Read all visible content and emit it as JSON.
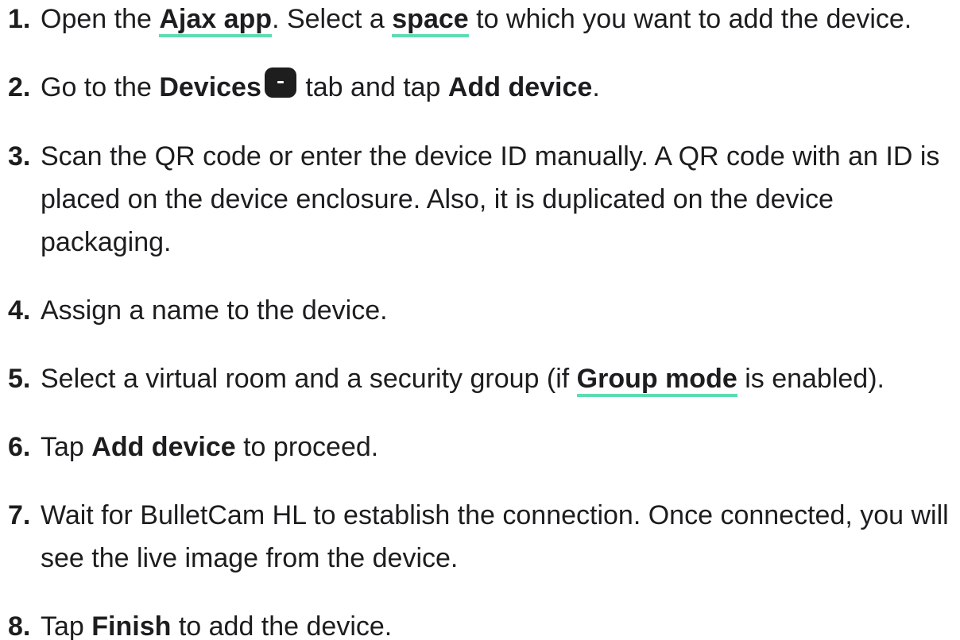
{
  "steps": [
    {
      "number": "1.",
      "t1": "Open the ",
      "link1": "Ajax app",
      "t2": ". Select a ",
      "link2": "space",
      "t3": " to which you want to add the device."
    },
    {
      "number": "2.",
      "t1": "Go to the ",
      "bold1": "Devices",
      "icon": "devices-tab-icon",
      "t2": " tab and tap ",
      "bold2": "Add device",
      "t3": "."
    },
    {
      "number": "3.",
      "text": "Scan the QR code or enter the device ID manually. A QR code with an ID is placed on the device enclosure. Also, it is duplicated on the device packaging."
    },
    {
      "number": "4.",
      "text": "Assign a name to the device."
    },
    {
      "number": "5.",
      "t1": "Select a virtual room and a security group (if ",
      "link1": "Group mode",
      "t2": " is enabled)."
    },
    {
      "number": "6.",
      "t1": "Tap ",
      "bold1": "Add device",
      "t2": " to proceed."
    },
    {
      "number": "7.",
      "text": "Wait for BulletCam HL to establish the connection. Once connected, you will see the live image from the device."
    },
    {
      "number": "8.",
      "t1": "Tap ",
      "bold1": "Finish",
      "t2": " to add the device."
    }
  ],
  "colors": {
    "text": "#1d1d1f",
    "link_underline": "#5ddcb0",
    "icon_bg": "#1e1e1e"
  }
}
